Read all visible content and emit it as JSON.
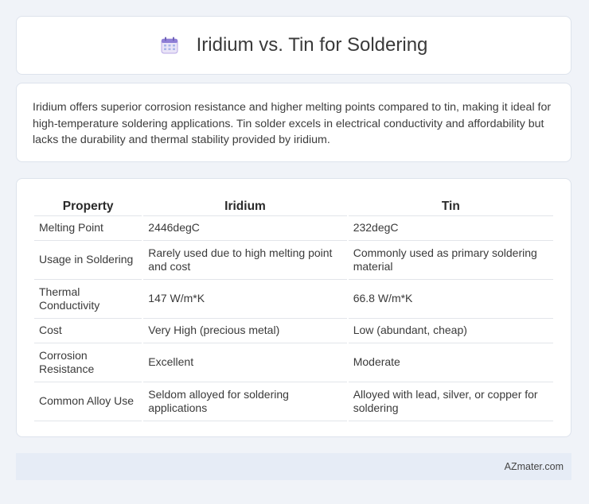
{
  "header": {
    "icon": "calendar-icon",
    "title": "Iridium vs. Tin for Soldering"
  },
  "intro": {
    "text": "Iridium offers superior corrosion resistance and higher melting points compared to tin, making it ideal for high-temperature soldering applications. Tin solder excels in electrical conductivity and affordability but lacks the durability and thermal stability provided by iridium."
  },
  "table": {
    "headers": [
      "Property",
      "Iridium",
      "Tin"
    ],
    "rows": [
      [
        "Melting Point",
        "2446degC",
        "232degC"
      ],
      [
        "Usage in Soldering",
        "Rarely used due to high melting point and cost",
        "Commonly used as primary soldering material"
      ],
      [
        "Thermal Conductivity",
        "147 W/m*K",
        "66.8 W/m*K"
      ],
      [
        "Cost",
        "Very High (precious metal)",
        "Low (abundant, cheap)"
      ],
      [
        "Corrosion Resistance",
        "Excellent",
        "Moderate"
      ],
      [
        "Common Alloy Use",
        "Seldom alloyed for soldering applications",
        "Alloyed with lead, silver, or copper for soldering"
      ]
    ]
  },
  "footer": {
    "brand": "AZmater.com"
  },
  "colors": {
    "background": "#f0f3f8",
    "card": "#ffffff",
    "footer": "#e6ecf6"
  }
}
